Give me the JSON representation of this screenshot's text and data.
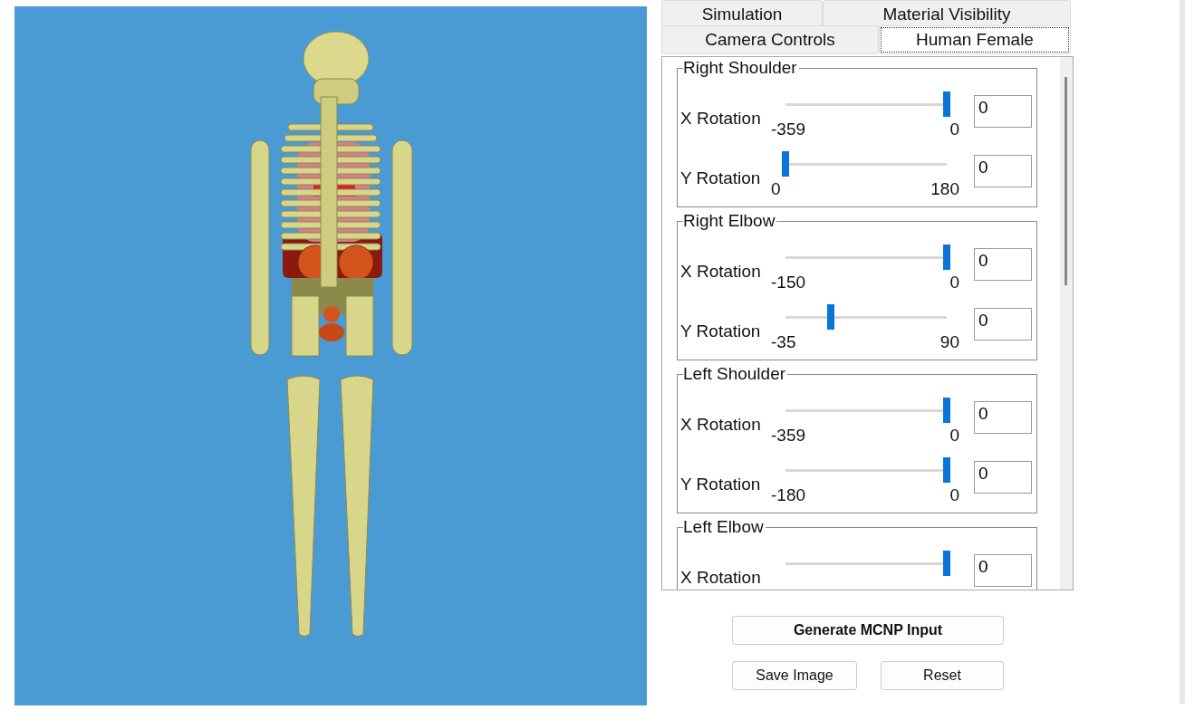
{
  "tab_rows": [
    [
      {
        "label": "Simulation",
        "selected": false
      },
      {
        "label": "Material Visibility",
        "selected": false
      }
    ],
    [
      {
        "label": "Camera Controls",
        "selected": false
      },
      {
        "label": "Human Female",
        "selected": true
      }
    ]
  ],
  "joints": [
    {
      "title": "Right Shoulder",
      "rows": [
        {
          "label": "X Rotation",
          "level": 1,
          "min": "-359",
          "max": "0",
          "value": "0"
        },
        {
          "label": "Y Rotation",
          "level": 0,
          "min": "0",
          "max": "180",
          "value": "0"
        }
      ]
    },
    {
      "title": "Right Elbow",
      "rows": [
        {
          "label": "X Rotation",
          "level": 1,
          "min": "-150",
          "max": "0",
          "value": "0"
        },
        {
          "label": "Y Rotation",
          "level": 0.28,
          "min": "-35",
          "max": "90",
          "value": "0"
        }
      ]
    },
    {
      "title": "Left Shoulder",
      "rows": [
        {
          "label": "X Rotation",
          "level": 1,
          "min": "-359",
          "max": "0",
          "value": "0"
        },
        {
          "label": "Y Rotation",
          "level": 1,
          "min": "-180",
          "max": "0",
          "value": "0"
        }
      ]
    },
    {
      "title": "Left Elbow",
      "rows": [
        {
          "label": "X Rotation",
          "level": 1,
          "value": "0"
        }
      ]
    }
  ],
  "generate_button": "Generate MCNP Input",
  "buttons": [
    "Save Image",
    "Reset"
  ]
}
